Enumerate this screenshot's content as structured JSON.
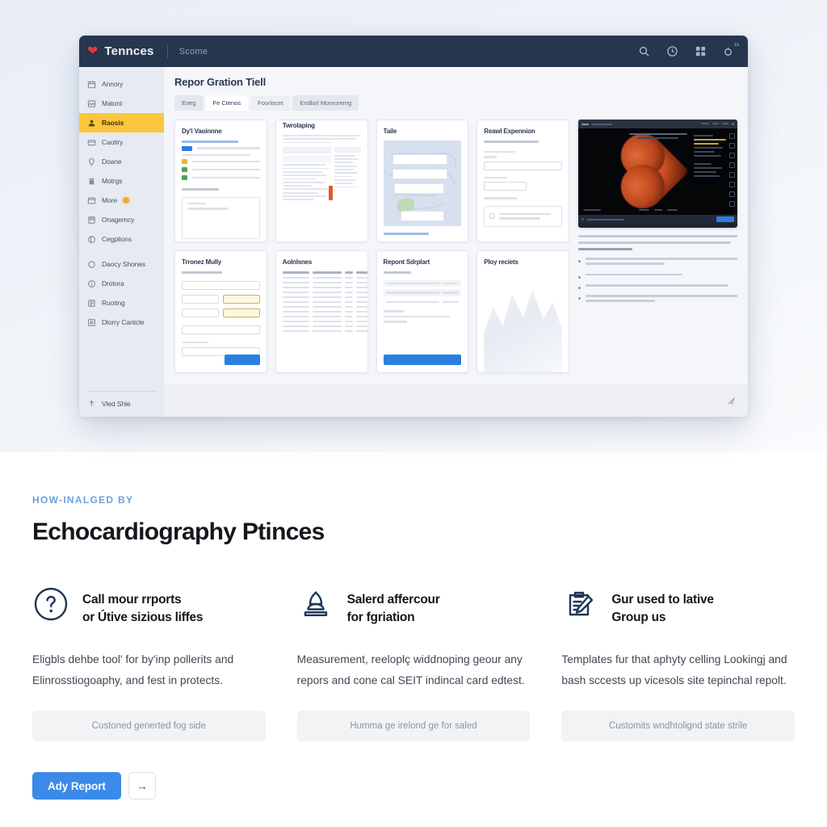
{
  "app": {
    "topbar": {
      "logo_icon": "heart-icon",
      "brand": "Tennces",
      "subtitle": "Scome",
      "icons": [
        {
          "name": "search-icon"
        },
        {
          "name": "clock-icon"
        },
        {
          "name": "grid-apps-icon"
        },
        {
          "name": "notification-bell-icon",
          "badge": "15"
        }
      ]
    },
    "sidebar": {
      "items": [
        {
          "label": "Annory",
          "icon": "calendar-icon",
          "active": false
        },
        {
          "label": "Matont",
          "icon": "image-icon",
          "active": false
        },
        {
          "label": "Raosis",
          "icon": "person-icon",
          "active": true
        },
        {
          "label": "Caotiry",
          "icon": "card-icon",
          "active": false
        },
        {
          "label": "Doane",
          "icon": "pin-icon",
          "active": false
        },
        {
          "label": "Motrgs",
          "icon": "building-icon",
          "active": false
        },
        {
          "label": "More",
          "icon": "window-icon",
          "active": false,
          "dot": true
        },
        {
          "label": "Onagemcy",
          "icon": "book-icon",
          "active": false
        },
        {
          "label": "Cegplions",
          "icon": "globe-icon",
          "active": false
        },
        {
          "label": "Daocy Shones",
          "icon": "circle-icon",
          "active": false
        },
        {
          "label": "Drotora",
          "icon": "info-icon",
          "active": false
        },
        {
          "label": "Ruoting",
          "icon": "note-icon",
          "active": false
        },
        {
          "label": "Dlorry Cantcle",
          "icon": "frame-icon",
          "active": false
        }
      ],
      "footer": {
        "label": "Vled Shle",
        "icon": "upload-icon"
      }
    },
    "main": {
      "title": "Repor Gration Tiell",
      "tabs": [
        {
          "label": "Eoeg",
          "active": false
        },
        {
          "label": "Fe Ctenos",
          "active": true
        },
        {
          "label": "Foorlocet",
          "active": false
        },
        {
          "label": "Endlorl Monruremg",
          "active": false
        }
      ],
      "cards": [
        {
          "title": "Dy'i Vaoinnne",
          "kind": "summary"
        },
        {
          "title": "Twrolaping",
          "kind": "dense-list"
        },
        {
          "title": "Taile",
          "kind": "map"
        },
        {
          "title": "Reawl Expennion",
          "kind": "form"
        },
        {
          "title": "Trronez Mully",
          "kind": "form-hl"
        },
        {
          "title": "Aolnlsnes",
          "kind": "table"
        },
        {
          "title": "Repont Sdrplart",
          "kind": "receipt"
        },
        {
          "title": "Ploy reciets",
          "kind": "chart"
        }
      ]
    },
    "detail": {
      "viewer": {
        "name": "echo-image-viewer",
        "caption": "ultrasound-heart-scan"
      },
      "heading_lines": 3,
      "bullets": 4
    },
    "footer": {
      "icon": "send-icon"
    }
  },
  "lower": {
    "eyebrow": "HOW-INALGED BY",
    "headline": "Echocardiography Ptinces",
    "features": [
      {
        "icon": "question-circle-icon",
        "title": "Call mour rrports\nor Útive sizious liffes",
        "body": "Eligbls dehbe tool' for by'inp pollerits and Elinrosstiogoaphy, and fest in protects.",
        "pill": "Custoned generted fog side"
      },
      {
        "icon": "bell-shape-icon",
        "title": "Salerd affercour\nfor fgriation",
        "body": "Measurement, reeloplç widdnoping geour any repors and cone cal SEIT indincal card edtest.",
        "pill": "Humma ge irelond ge for saled"
      },
      {
        "icon": "clipboard-pencil-icon",
        "title": "Gur used to lative\nGroup us",
        "body": "Templates fur that aphyty celling Lookingj and bash sccests up vicesols site tepinchal repolt.",
        "pill": "Customits wndhtolignd state strile"
      }
    ],
    "cta": {
      "primary_label": "Ady Report",
      "arrow_icon": "arrow-right-icon"
    }
  },
  "colors": {
    "topbar": "#27364f",
    "accent_blue": "#3b8ae8",
    "sidebar_active": "#fbc63c",
    "eyebrow": "#6da2d9",
    "heart_red": "#e23b3b"
  }
}
